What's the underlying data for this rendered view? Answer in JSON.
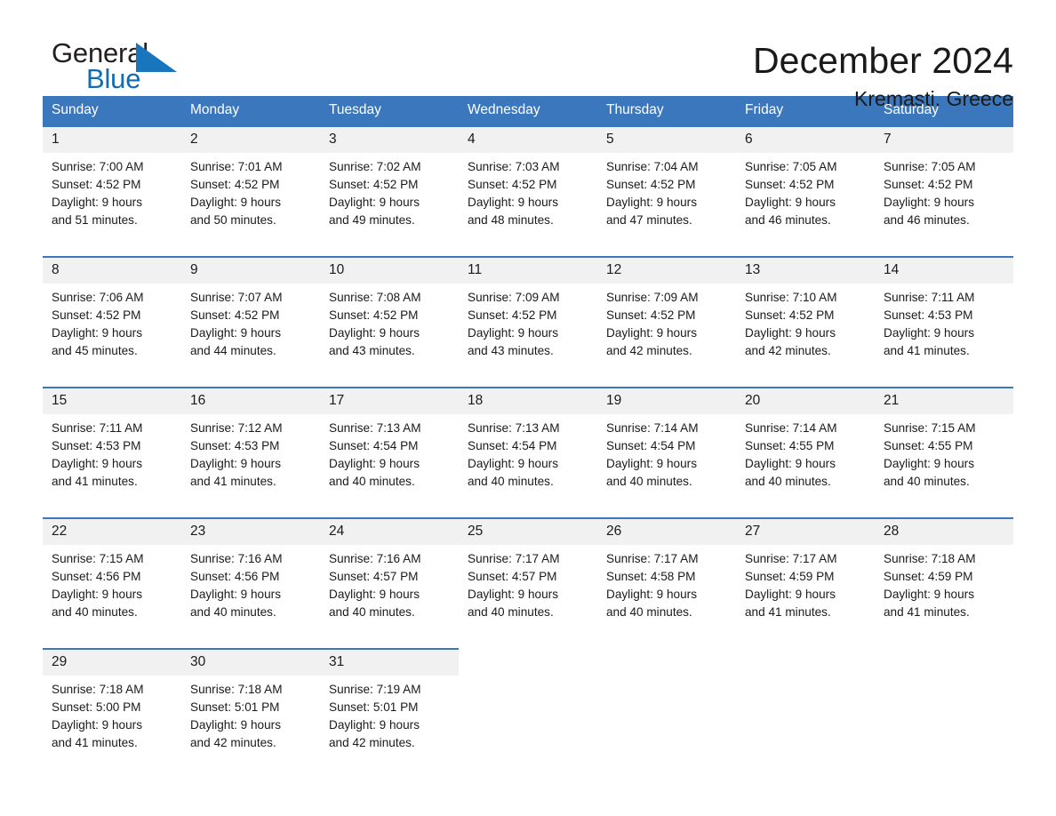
{
  "brand": {
    "word_one": "General",
    "word_two": "Blue",
    "triangle_color": "#1a76bc",
    "blue_text_color": "#0f6cb5"
  },
  "header": {
    "month_title": "December 2024",
    "location": "Kremasti, Greece"
  },
  "theme": {
    "header_blue": "#3b77bc",
    "daynum_band": "#f1f1f1",
    "rule_blue": "#3b77bc",
    "text": "#1a1a1a"
  },
  "calendar": {
    "weekday_headers": [
      "Sunday",
      "Monday",
      "Tuesday",
      "Wednesday",
      "Thursday",
      "Friday",
      "Saturday"
    ],
    "weeks": [
      [
        {
          "day": "1",
          "sunrise": "Sunrise: 7:00 AM",
          "sunset": "Sunset: 4:52 PM",
          "daylight_line1": "Daylight: 9 hours",
          "daylight_line2": "and 51 minutes."
        },
        {
          "day": "2",
          "sunrise": "Sunrise: 7:01 AM",
          "sunset": "Sunset: 4:52 PM",
          "daylight_line1": "Daylight: 9 hours",
          "daylight_line2": "and 50 minutes."
        },
        {
          "day": "3",
          "sunrise": "Sunrise: 7:02 AM",
          "sunset": "Sunset: 4:52 PM",
          "daylight_line1": "Daylight: 9 hours",
          "daylight_line2": "and 49 minutes."
        },
        {
          "day": "4",
          "sunrise": "Sunrise: 7:03 AM",
          "sunset": "Sunset: 4:52 PM",
          "daylight_line1": "Daylight: 9 hours",
          "daylight_line2": "and 48 minutes."
        },
        {
          "day": "5",
          "sunrise": "Sunrise: 7:04 AM",
          "sunset": "Sunset: 4:52 PM",
          "daylight_line1": "Daylight: 9 hours",
          "daylight_line2": "and 47 minutes."
        },
        {
          "day": "6",
          "sunrise": "Sunrise: 7:05 AM",
          "sunset": "Sunset: 4:52 PM",
          "daylight_line1": "Daylight: 9 hours",
          "daylight_line2": "and 46 minutes."
        },
        {
          "day": "7",
          "sunrise": "Sunrise: 7:05 AM",
          "sunset": "Sunset: 4:52 PM",
          "daylight_line1": "Daylight: 9 hours",
          "daylight_line2": "and 46 minutes."
        }
      ],
      [
        {
          "day": "8",
          "sunrise": "Sunrise: 7:06 AM",
          "sunset": "Sunset: 4:52 PM",
          "daylight_line1": "Daylight: 9 hours",
          "daylight_line2": "and 45 minutes."
        },
        {
          "day": "9",
          "sunrise": "Sunrise: 7:07 AM",
          "sunset": "Sunset: 4:52 PM",
          "daylight_line1": "Daylight: 9 hours",
          "daylight_line2": "and 44 minutes."
        },
        {
          "day": "10",
          "sunrise": "Sunrise: 7:08 AM",
          "sunset": "Sunset: 4:52 PM",
          "daylight_line1": "Daylight: 9 hours",
          "daylight_line2": "and 43 minutes."
        },
        {
          "day": "11",
          "sunrise": "Sunrise: 7:09 AM",
          "sunset": "Sunset: 4:52 PM",
          "daylight_line1": "Daylight: 9 hours",
          "daylight_line2": "and 43 minutes."
        },
        {
          "day": "12",
          "sunrise": "Sunrise: 7:09 AM",
          "sunset": "Sunset: 4:52 PM",
          "daylight_line1": "Daylight: 9 hours",
          "daylight_line2": "and 42 minutes."
        },
        {
          "day": "13",
          "sunrise": "Sunrise: 7:10 AM",
          "sunset": "Sunset: 4:52 PM",
          "daylight_line1": "Daylight: 9 hours",
          "daylight_line2": "and 42 minutes."
        },
        {
          "day": "14",
          "sunrise": "Sunrise: 7:11 AM",
          "sunset": "Sunset: 4:53 PM",
          "daylight_line1": "Daylight: 9 hours",
          "daylight_line2": "and 41 minutes."
        }
      ],
      [
        {
          "day": "15",
          "sunrise": "Sunrise: 7:11 AM",
          "sunset": "Sunset: 4:53 PM",
          "daylight_line1": "Daylight: 9 hours",
          "daylight_line2": "and 41 minutes."
        },
        {
          "day": "16",
          "sunrise": "Sunrise: 7:12 AM",
          "sunset": "Sunset: 4:53 PM",
          "daylight_line1": "Daylight: 9 hours",
          "daylight_line2": "and 41 minutes."
        },
        {
          "day": "17",
          "sunrise": "Sunrise: 7:13 AM",
          "sunset": "Sunset: 4:54 PM",
          "daylight_line1": "Daylight: 9 hours",
          "daylight_line2": "and 40 minutes."
        },
        {
          "day": "18",
          "sunrise": "Sunrise: 7:13 AM",
          "sunset": "Sunset: 4:54 PM",
          "daylight_line1": "Daylight: 9 hours",
          "daylight_line2": "and 40 minutes."
        },
        {
          "day": "19",
          "sunrise": "Sunrise: 7:14 AM",
          "sunset": "Sunset: 4:54 PM",
          "daylight_line1": "Daylight: 9 hours",
          "daylight_line2": "and 40 minutes."
        },
        {
          "day": "20",
          "sunrise": "Sunrise: 7:14 AM",
          "sunset": "Sunset: 4:55 PM",
          "daylight_line1": "Daylight: 9 hours",
          "daylight_line2": "and 40 minutes."
        },
        {
          "day": "21",
          "sunrise": "Sunrise: 7:15 AM",
          "sunset": "Sunset: 4:55 PM",
          "daylight_line1": "Daylight: 9 hours",
          "daylight_line2": "and 40 minutes."
        }
      ],
      [
        {
          "day": "22",
          "sunrise": "Sunrise: 7:15 AM",
          "sunset": "Sunset: 4:56 PM",
          "daylight_line1": "Daylight: 9 hours",
          "daylight_line2": "and 40 minutes."
        },
        {
          "day": "23",
          "sunrise": "Sunrise: 7:16 AM",
          "sunset": "Sunset: 4:56 PM",
          "daylight_line1": "Daylight: 9 hours",
          "daylight_line2": "and 40 minutes."
        },
        {
          "day": "24",
          "sunrise": "Sunrise: 7:16 AM",
          "sunset": "Sunset: 4:57 PM",
          "daylight_line1": "Daylight: 9 hours",
          "daylight_line2": "and 40 minutes."
        },
        {
          "day": "25",
          "sunrise": "Sunrise: 7:17 AM",
          "sunset": "Sunset: 4:57 PM",
          "daylight_line1": "Daylight: 9 hours",
          "daylight_line2": "and 40 minutes."
        },
        {
          "day": "26",
          "sunrise": "Sunrise: 7:17 AM",
          "sunset": "Sunset: 4:58 PM",
          "daylight_line1": "Daylight: 9 hours",
          "daylight_line2": "and 40 minutes."
        },
        {
          "day": "27",
          "sunrise": "Sunrise: 7:17 AM",
          "sunset": "Sunset: 4:59 PM",
          "daylight_line1": "Daylight: 9 hours",
          "daylight_line2": "and 41 minutes."
        },
        {
          "day": "28",
          "sunrise": "Sunrise: 7:18 AM",
          "sunset": "Sunset: 4:59 PM",
          "daylight_line1": "Daylight: 9 hours",
          "daylight_line2": "and 41 minutes."
        }
      ],
      [
        {
          "day": "29",
          "sunrise": "Sunrise: 7:18 AM",
          "sunset": "Sunset: 5:00 PM",
          "daylight_line1": "Daylight: 9 hours",
          "daylight_line2": "and 41 minutes."
        },
        {
          "day": "30",
          "sunrise": "Sunrise: 7:18 AM",
          "sunset": "Sunset: 5:01 PM",
          "daylight_line1": "Daylight: 9 hours",
          "daylight_line2": "and 42 minutes."
        },
        {
          "day": "31",
          "sunrise": "Sunrise: 7:19 AM",
          "sunset": "Sunset: 5:01 PM",
          "daylight_line1": "Daylight: 9 hours",
          "daylight_line2": "and 42 minutes."
        },
        {
          "day": "",
          "sunrise": "",
          "sunset": "",
          "daylight_line1": "",
          "daylight_line2": ""
        },
        {
          "day": "",
          "sunrise": "",
          "sunset": "",
          "daylight_line1": "",
          "daylight_line2": ""
        },
        {
          "day": "",
          "sunrise": "",
          "sunset": "",
          "daylight_line1": "",
          "daylight_line2": ""
        },
        {
          "day": "",
          "sunrise": "",
          "sunset": "",
          "daylight_line1": "",
          "daylight_line2": ""
        }
      ]
    ]
  }
}
